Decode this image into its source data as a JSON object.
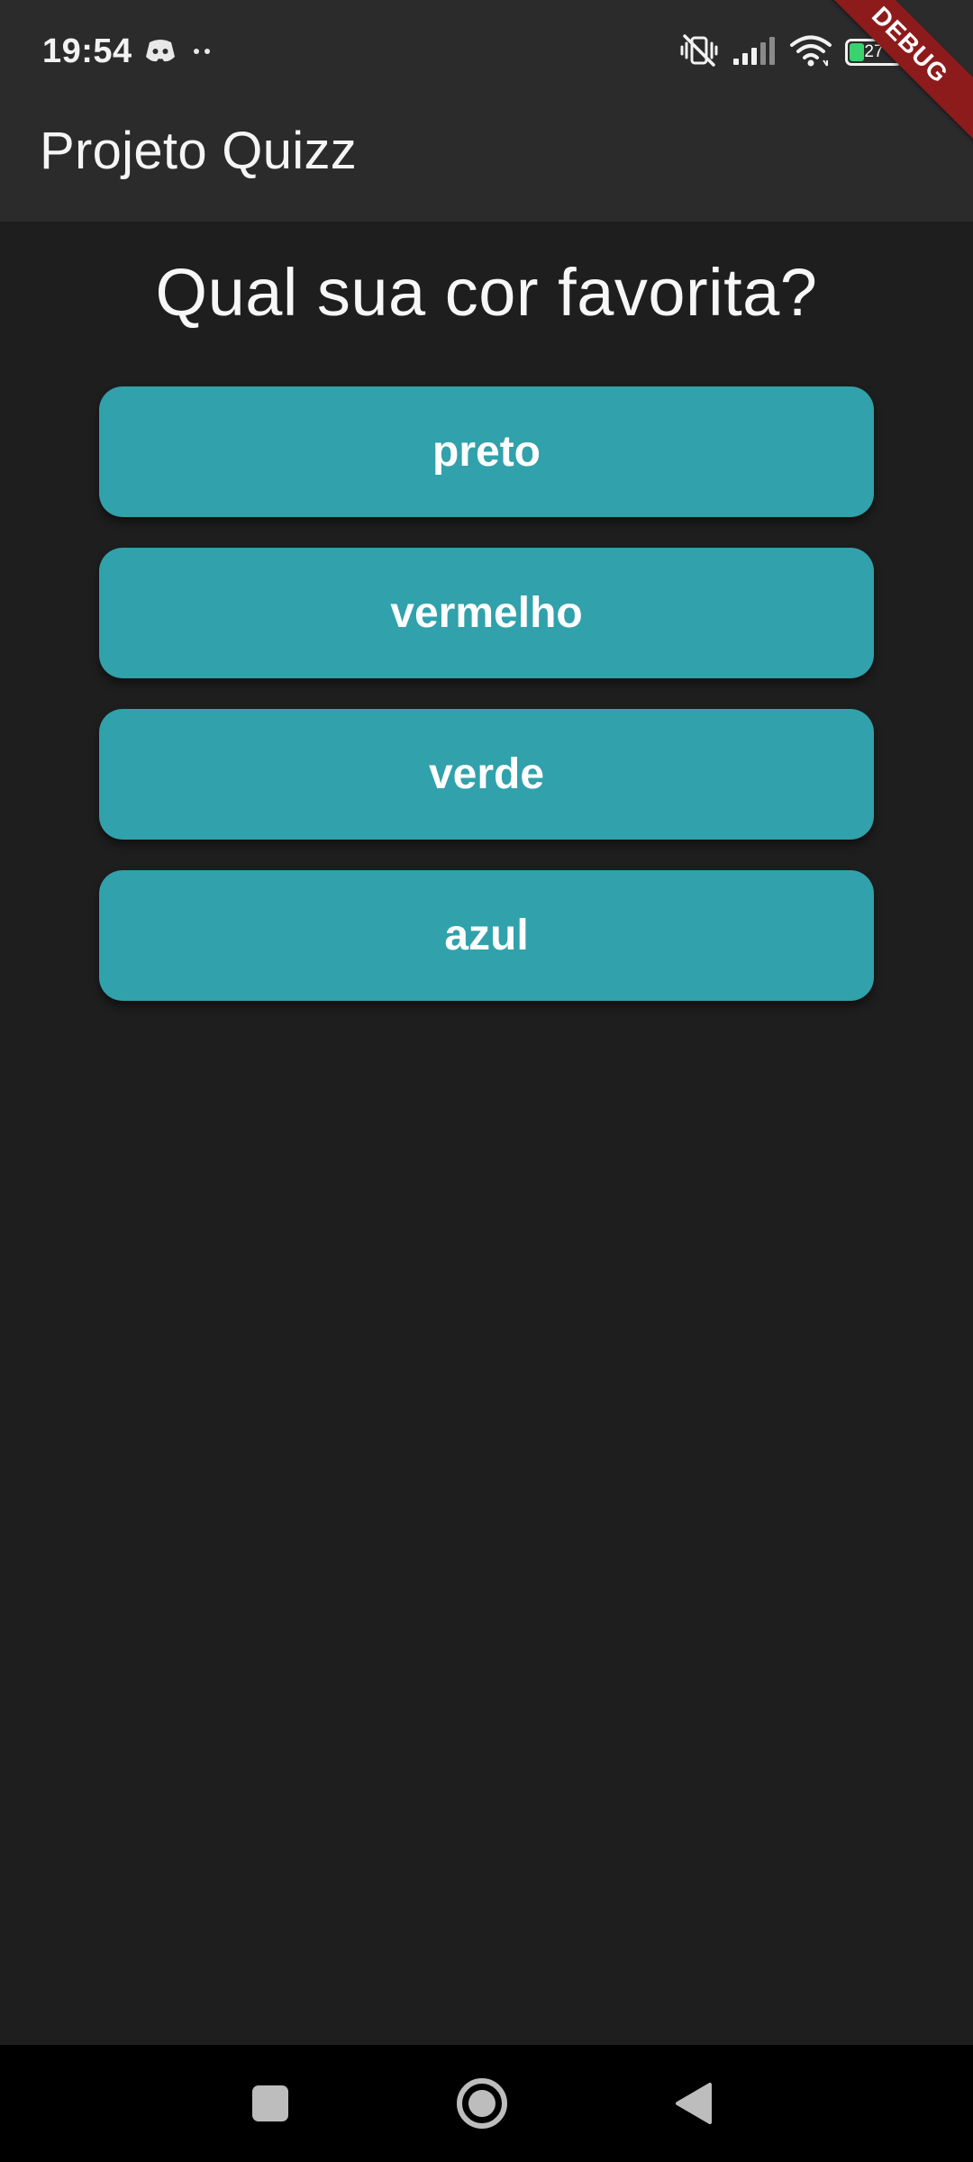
{
  "status_bar": {
    "time": "19:54",
    "battery_level": "27",
    "battery_fraction": 0.27,
    "left_icons": [
      "discord-icon",
      "more-dots-icon"
    ],
    "right_icons": [
      "vibrate-off-icon",
      "signal-icon",
      "wifi-icon",
      "battery-icon"
    ]
  },
  "app_bar": {
    "title": "Projeto Quizz"
  },
  "debug_banner": {
    "label": "DEBUG",
    "color": "#8e1b1b"
  },
  "quiz": {
    "question": "Qual sua cor favorita?",
    "answers": [
      {
        "label": "preto"
      },
      {
        "label": "vermelho"
      },
      {
        "label": "verde"
      },
      {
        "label": "azul"
      }
    ],
    "button_color": "#31a1ab"
  },
  "nav_bar": {
    "icons": [
      "recent-apps-icon",
      "home-icon",
      "back-icon"
    ]
  },
  "colors": {
    "background": "#1e1e1e",
    "app_bar": "#2b2b2b",
    "nav_bar": "#000000"
  }
}
